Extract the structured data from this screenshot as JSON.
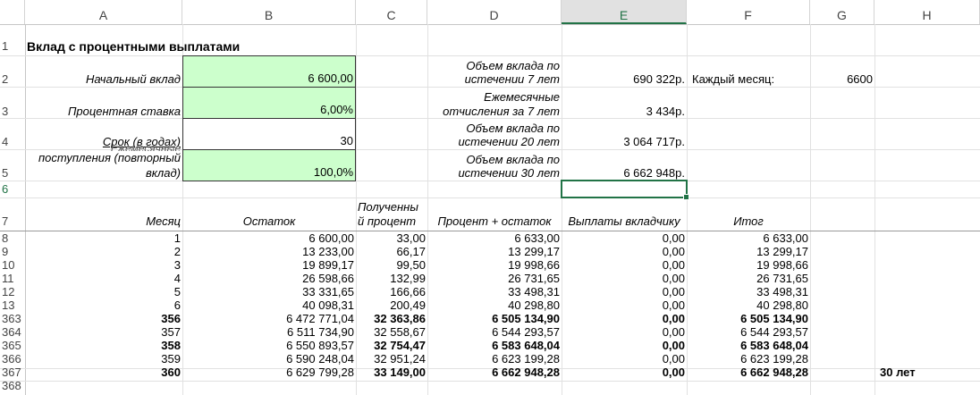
{
  "columns": [
    "A",
    "B",
    "C",
    "D",
    "E",
    "F",
    "G",
    "H"
  ],
  "rows": {
    "r1": "1",
    "r2": "2",
    "r3": "3",
    "r4": "4",
    "r5": "5",
    "r6": "6",
    "r7": "7",
    "r8": "8",
    "r9": "9",
    "r10": "10",
    "r11": "11",
    "r12": "12",
    "r13": "13",
    "r363": "363",
    "r364": "364",
    "r365": "365",
    "r366": "366",
    "r367": "367",
    "r368": "368"
  },
  "title": "Вклад с процентными выплатами",
  "inputs": {
    "initial_label": "Начальный вклад",
    "initial_value": "6 600,00",
    "rate_label": "Процентная ставка",
    "rate_value": "6,00%",
    "term_label": "Срок (в годах)",
    "term_value": "30",
    "reinvest_label_top": "Ежемесячные",
    "reinvest_label_mid": "поступления (повторный",
    "reinvest_label_bot": "вклад)",
    "reinvest_value": "100,0%"
  },
  "summary": {
    "vol7_line1": "Объем вклада по",
    "vol7_line2": "истечении 7 лет",
    "vol7_value": "690 322р.",
    "monthly_line1": "Ежемесячные",
    "monthly_line2": "отчисления за 7 лет",
    "monthly_value": "3 434р.",
    "vol20_line1": "Объем вклада по",
    "vol20_line2": "истечении 20 лет",
    "vol20_value": "3 064 717р.",
    "vol30_line1": "Объем вклада по",
    "vol30_line2": "истечении 30 лет",
    "vol30_value": "6 662 948р.",
    "each_month_label": "Каждый месяц:",
    "each_month_value": "6600"
  },
  "table": {
    "h_month": "Месяц",
    "h_balance": "Остаток",
    "h_received_1": "Полученны",
    "h_received_2": "й процент",
    "h_pct_plus": "Процент + остаток",
    "h_payout": "Выплаты вкладчику",
    "h_total": "Итог",
    "rows": [
      {
        "m": "1",
        "bal": "6 600,00",
        "pct": "33,00",
        "sum": "6 633,00",
        "pay": "0,00",
        "tot": "6 633,00"
      },
      {
        "m": "2",
        "bal": "13 233,00",
        "pct": "66,17",
        "sum": "13 299,17",
        "pay": "0,00",
        "tot": "13 299,17"
      },
      {
        "m": "3",
        "bal": "19 899,17",
        "pct": "99,50",
        "sum": "19 998,66",
        "pay": "0,00",
        "tot": "19 998,66"
      },
      {
        "m": "4",
        "bal": "26 598,66",
        "pct": "132,99",
        "sum": "26 731,65",
        "pay": "0,00",
        "tot": "26 731,65"
      },
      {
        "m": "5",
        "bal": "33 331,65",
        "pct": "166,66",
        "sum": "33 498,31",
        "pay": "0,00",
        "tot": "33 498,31"
      },
      {
        "m": "6",
        "bal": "40 098,31",
        "pct": "200,49",
        "sum": "40 298,80",
        "pay": "0,00",
        "tot": "40 298,80"
      },
      {
        "m": "356",
        "bal": "6 472 771,04",
        "pct": "32 363,86",
        "sum": "6 505 134,90",
        "pay": "0,00",
        "tot": "6 505 134,90"
      },
      {
        "m": "357",
        "bal": "6 511 734,90",
        "pct": "32 558,67",
        "sum": "6 544 293,57",
        "pay": "0,00",
        "tot": "6 544 293,57"
      },
      {
        "m": "358",
        "bal": "6 550 893,57",
        "pct": "32 754,47",
        "sum": "6 583 648,04",
        "pay": "0,00",
        "tot": "6 583 648,04"
      },
      {
        "m": "359",
        "bal": "6 590 248,04",
        "pct": "32 951,24",
        "sum": "6 623 199,28",
        "pay": "0,00",
        "tot": "6 623 199,28"
      },
      {
        "m": "360",
        "bal": "6 629 799,28",
        "pct": "33 149,00",
        "sum": "6 662 948,28",
        "pay": "0,00",
        "tot": "6 662 948,28"
      }
    ],
    "h_30": "30 лет"
  }
}
